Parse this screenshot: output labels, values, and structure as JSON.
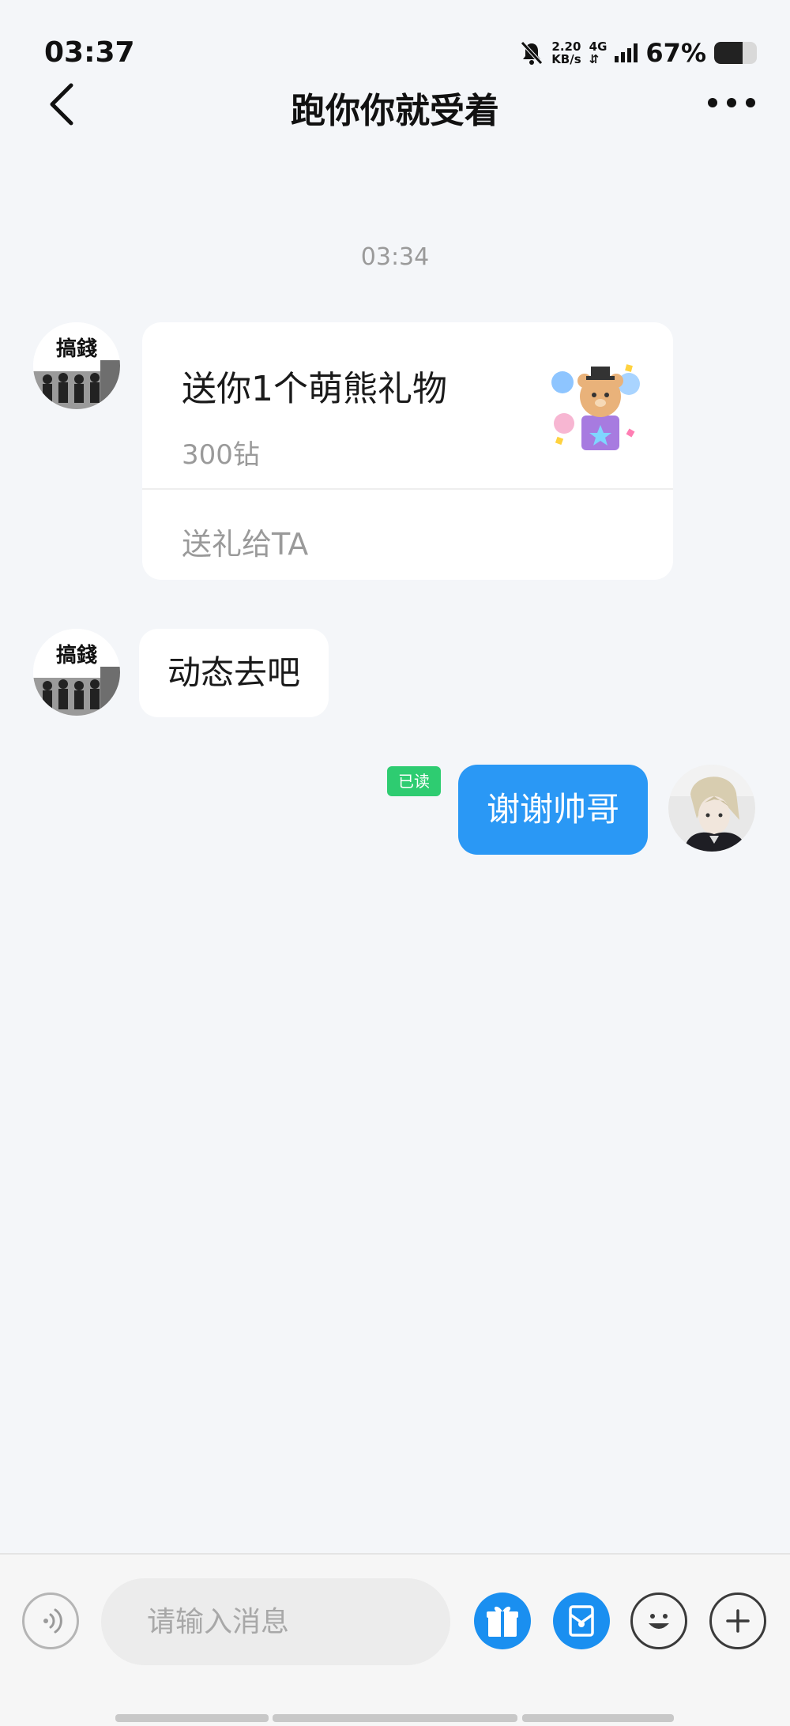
{
  "status_bar": {
    "time": "03:37",
    "net_speed_value": "2.20",
    "net_speed_unit": "KB/s",
    "network_type": "4G",
    "battery_percent": "67%",
    "battery_level": 0.67
  },
  "header": {
    "title": "跑你你就受着"
  },
  "chat": {
    "timestamp": "03:34",
    "gift_message": {
      "title": "送你1个萌熊礼物",
      "price": "300钻",
      "action_label": "送礼给TA"
    },
    "incoming_text": "动态去吧",
    "outgoing_text": "谢谢帅哥",
    "read_status": "已读",
    "contact_avatar_text": "搞錢"
  },
  "input_bar": {
    "placeholder": "请输入消息"
  },
  "colors": {
    "accent": "#2a98f5",
    "read_badge": "#2ecc71",
    "background": "#f4f6f9"
  }
}
